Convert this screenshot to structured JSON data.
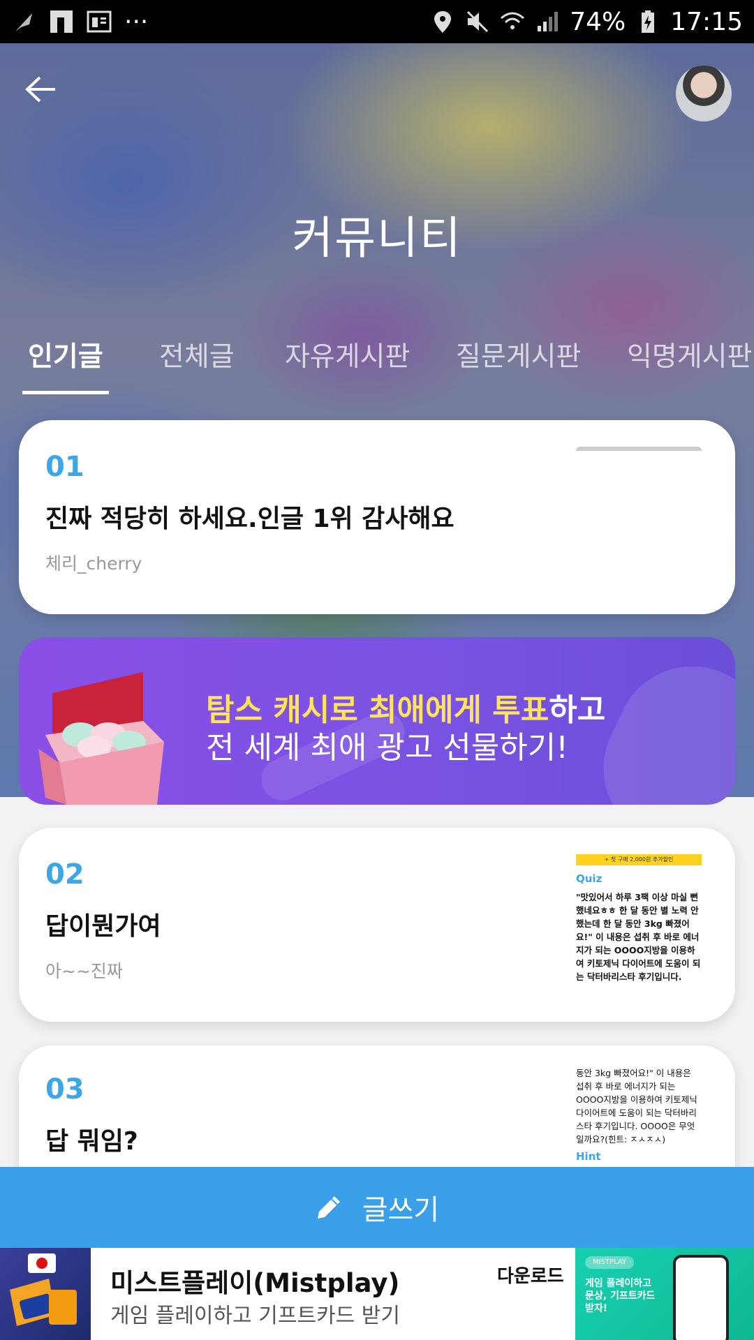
{
  "status_bar": {
    "battery": "74%",
    "time": "17:15",
    "more": "···"
  },
  "header": {
    "title": "커뮤니티"
  },
  "tabs": [
    {
      "label": "인기글",
      "active": true
    },
    {
      "label": "전체글",
      "active": false
    },
    {
      "label": "자유게시판",
      "active": false
    },
    {
      "label": "질문게시판",
      "active": false
    },
    {
      "label": "익명게시판",
      "active": false
    }
  ],
  "posts": [
    {
      "rank": "01",
      "title": "진짜 적당히 하세요.인글 1위 감사해요",
      "author": "체리_cherry"
    },
    {
      "rank": "02",
      "title": "답이뭔가여",
      "author": "아~~진짜",
      "thumb": {
        "bar": "+ 첫 구매 2,000원 추가할인",
        "heading": "Quiz",
        "text": "\"맛있어서 하루 3팩 이상 마실 뻔 했네요ㅎㅎ 한 달 동안 별 노력 안했는데 한 달 동안 3kg 빠졌어요!\" 이 내용은 섭취 후 바로 에너지가 되는 OOOO지방을 이용하여 키토제닉 다이어트에 도움이 되는 닥터바리스타 후기입니다."
      }
    },
    {
      "rank": "03",
      "title": "답 뭐임?",
      "author": "",
      "thumb": {
        "text": "동안 3kg 빠졌어요!\" 이 내용은 섭취 후 바로 에너지가 되는 OOOO지방을 이용하여 키토제닉 다이어트에 도움이 되는 닥터바리스타 후기입니다. OOOO은 무엇일까요?(힌트: ㅈㅅㅈㅅ)",
        "heading": "Hint"
      }
    }
  ],
  "banner": {
    "line1_highlight": "탐스 캐시로 최애에게 투표",
    "line1_rest": "하고",
    "line2": "전 세계 최애 광고 선물하기!"
  },
  "write_button": {
    "label": "글쓰기"
  },
  "ad": {
    "title": "미스트플레이(Mistplay)",
    "subtitle": "게임 플레이하고 기프트카드 받기",
    "download": "다운로드",
    "right_logo": "MISTPLAY",
    "right_text": "게임 플레이하고 문상, 기프트카드 받자!"
  },
  "colors": {
    "accent": "#3ba6e8",
    "write_bar": "#3a9fe9",
    "banner": "#7a52e3",
    "banner_highlight": "#ffe45a"
  }
}
